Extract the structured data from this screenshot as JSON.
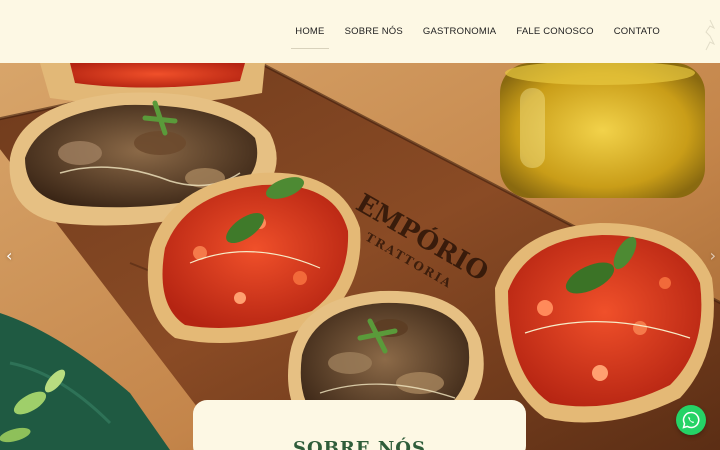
{
  "nav": {
    "items": [
      {
        "label": "HOME",
        "active": true
      },
      {
        "label": "SOBRE NÓS"
      },
      {
        "label": "GASTRONOMIA"
      },
      {
        "label": "FALE CONOSCO"
      },
      {
        "label": "CONTATO"
      }
    ]
  },
  "hero": {
    "board_text_line1": "EMPÓRIO",
    "board_text_line2": "TRATTORIA",
    "prev_icon": "chevron-left-icon",
    "next_icon": "chevron-right-icon"
  },
  "about": {
    "title": "SOBRE NÓS"
  },
  "whatsapp": {
    "icon": "whatsapp-icon",
    "color": "#25d366"
  },
  "colors": {
    "background": "#fdf8e4",
    "accent_green": "#2f5d3a"
  }
}
